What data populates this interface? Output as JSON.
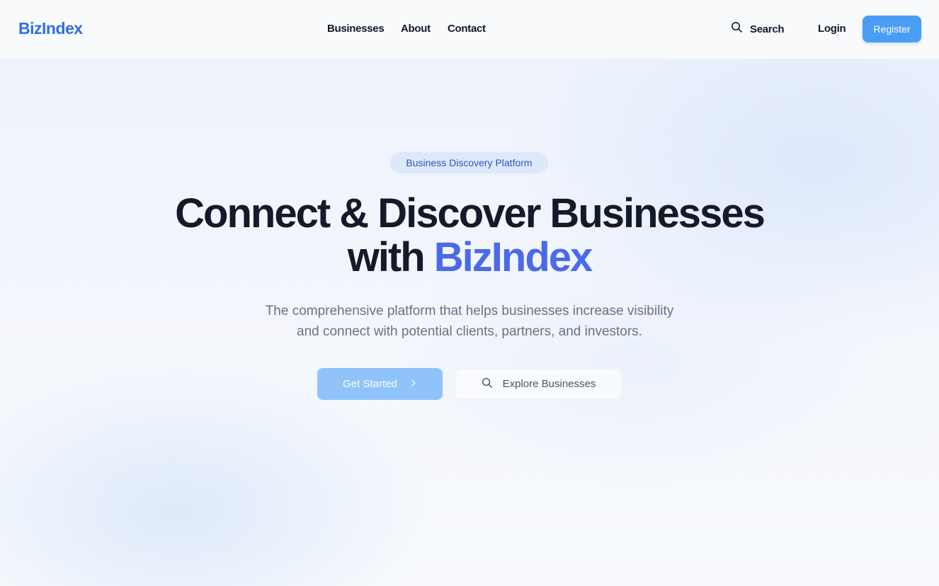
{
  "header": {
    "logo": "BizIndex",
    "nav": [
      "Businesses",
      "About",
      "Contact"
    ],
    "search_label": "Search",
    "login_label": "Login",
    "register_label": "Register",
    "brand_color": "#2f6fe0",
    "register_color": "#4a9df5"
  },
  "hero": {
    "badge": "Business Discovery Platform",
    "headline_line1": "Connect & Discover Businesses",
    "headline_prefix": "with ",
    "headline_accent": "BizIndex",
    "subtitle_line1": "The comprehensive platform that helps businesses increase visibility",
    "subtitle_line2": "and connect with potential clients, partners, and investors.",
    "cta_primary": "Get Started",
    "cta_secondary": "Explore Businesses",
    "accent_color": "#4a6ae8"
  },
  "icons": {
    "search": "search-icon",
    "arrow": "chevron-right-icon"
  }
}
